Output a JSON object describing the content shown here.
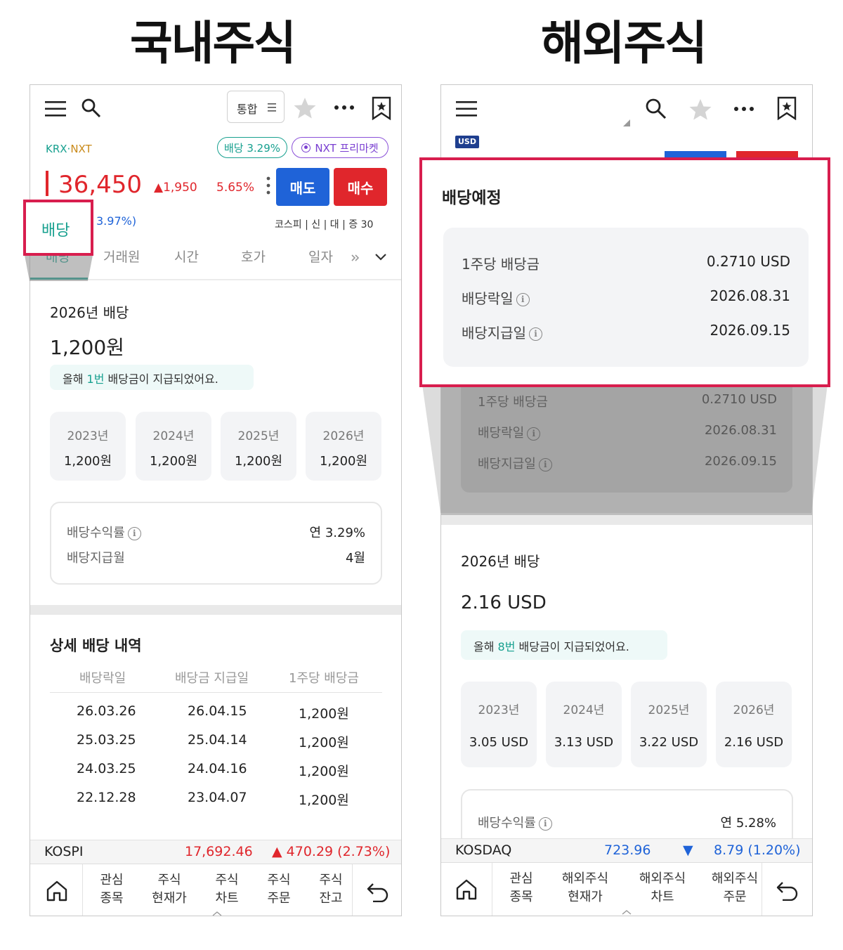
{
  "titles": {
    "left": "국내주식",
    "right": "해외주식"
  },
  "left": {
    "toolbar": {
      "dropdown": "통합"
    },
    "market_tag": {
      "krx": "KRX",
      "dot": "·",
      "nxt": "NXT"
    },
    "badges": {
      "dividend": "배당 3.29%",
      "nxt_premarket": "NXT 프리마켓"
    },
    "price": {
      "value": "36,450",
      "change": "▲1,950",
      "change_pct": "5.65%",
      "sub_pct": "3.97%)"
    },
    "buttons": {
      "sell": "매도",
      "buy": "매수"
    },
    "market_info": "코스피 | 신 | 대 | 증 30",
    "highlight_label": "배당",
    "tabs": [
      "배당",
      "거래원",
      "시간",
      "호가",
      "일자"
    ],
    "dividend": {
      "heading": "2026년 배당",
      "amount": "1,200원",
      "notice_prefix": "올해 ",
      "notice_count": "1번",
      "notice_suffix": " 배당금이 지급되었어요.",
      "years": [
        {
          "year": "2023년",
          "value": "1,200원"
        },
        {
          "year": "2024년",
          "value": "1,200원"
        },
        {
          "year": "2025년",
          "value": "1,200원"
        },
        {
          "year": "2026년",
          "value": "1,200원"
        }
      ],
      "yield_label": "배당수익률",
      "yield_value": "연 3.29%",
      "pay_month_label": "배당지급월",
      "pay_month_value": "4월"
    },
    "detail": {
      "heading": "상세 배당 내역",
      "columns": [
        "배당락일",
        "배당금 지급일",
        "1주당 배당금"
      ],
      "rows": [
        [
          "26.03.26",
          "26.04.15",
          "1,200원"
        ],
        [
          "25.03.25",
          "25.04.14",
          "1,200원"
        ],
        [
          "24.03.25",
          "24.04.16",
          "1,200원"
        ],
        [
          "22.12.28",
          "23.04.07",
          "1,200원"
        ]
      ]
    },
    "ticker": {
      "name": "KOSPI",
      "value": "17,692.46",
      "change": "▲  470.29 (2.73%)"
    },
    "nav": [
      "관심\n종목",
      "주식\n현재가",
      "주식\n차트",
      "주식\n주문",
      "주식\n잔고"
    ]
  },
  "right": {
    "currency_tag": "USD",
    "zoom": {
      "heading": "배당예정",
      "rows": [
        {
          "label": "1주당 배당금",
          "value": "0.2710 USD"
        },
        {
          "label": "배당락일",
          "value": "2026.08.31"
        },
        {
          "label": "배당지급일",
          "value": "2026.09.15"
        }
      ]
    },
    "dividend": {
      "heading": "2026년 배당",
      "amount": "2.16 USD",
      "notice_prefix": "올해 ",
      "notice_count": "8번",
      "notice_suffix": " 배당금이 지급되었어요.",
      "years": [
        {
          "year": "2023년",
          "value": "3.05 USD"
        },
        {
          "year": "2024년",
          "value": "3.13 USD"
        },
        {
          "year": "2025년",
          "value": "3.22 USD"
        },
        {
          "year": "2026년",
          "value": "2.16 USD"
        }
      ],
      "yield_label": "배당수익률",
      "yield_value": "연 5.28%"
    },
    "ticker": {
      "name": "KOSDAQ",
      "value": "723.96",
      "arrow": "▼",
      "change": "8.79 (1.20%)"
    },
    "nav": [
      "관심\n종목",
      "해외주식\n현재가",
      "해외주식\n차트",
      "해외주식\n주문"
    ]
  },
  "colors": {
    "accent_teal": "#17a08f",
    "red": "#e0262c",
    "blue": "#1f63d8",
    "highlight": "#d81e4e"
  }
}
